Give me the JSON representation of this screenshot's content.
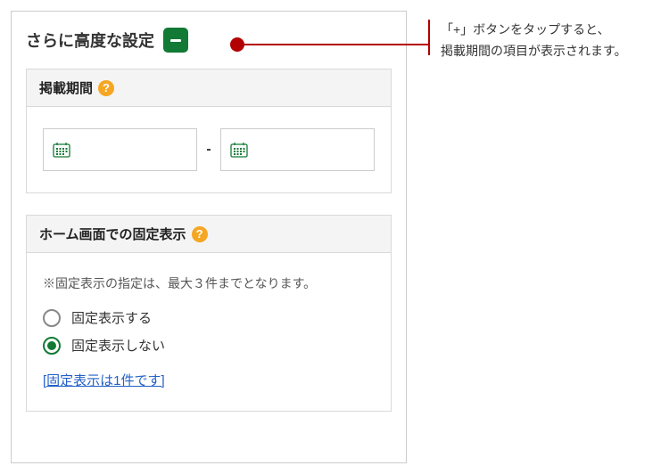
{
  "panel": {
    "title": "さらに高度な設定"
  },
  "sections": {
    "period": {
      "title": "掲載期間",
      "separator": "-"
    },
    "pinned": {
      "title": "ホーム画面での固定表示",
      "note": "※固定表示の指定は、最大３件までとなります。",
      "options": [
        {
          "label": "固定表示する",
          "selected": false
        },
        {
          "label": "固定表示しない",
          "selected": true
        }
      ],
      "link": "[固定表示は1件です]"
    }
  },
  "callout": {
    "line1": "「+」ボタンをタップすると、",
    "line2": "掲載期間の項目が表示されます。"
  },
  "help_glyph": "?"
}
